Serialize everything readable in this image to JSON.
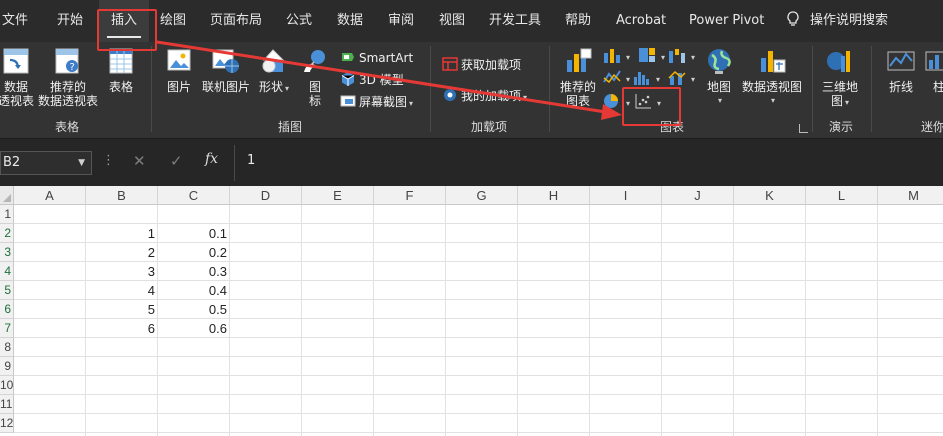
{
  "tabs": [
    {
      "label": "文件"
    },
    {
      "label": "开始"
    },
    {
      "label": "插入"
    },
    {
      "label": "绘图"
    },
    {
      "label": "页面布局"
    },
    {
      "label": "公式"
    },
    {
      "label": "数据"
    },
    {
      "label": "审阅"
    },
    {
      "label": "视图"
    },
    {
      "label": "开发工具"
    },
    {
      "label": "帮助"
    },
    {
      "label": "Acrobat"
    },
    {
      "label": "Power Pivot"
    },
    {
      "label": "操作说明搜索"
    }
  ],
  "ribbon": {
    "tables": {
      "pivot_label_1": "数据",
      "pivot_label_2": "透视表",
      "recommended_pivot_1": "推荐的",
      "recommended_pivot_2": "数据透视表",
      "table_label": "表格",
      "group_label": "表格"
    },
    "illustrations": {
      "pictures": "图片",
      "online_pictures": "联机图片",
      "shapes": "形状",
      "icons_1": "图",
      "icons_2": "标",
      "smartart": "SmartArt",
      "model3d": "3D 模型",
      "screenshot": "屏幕截图",
      "group_label": "插图"
    },
    "addins": {
      "get_addins": "获取加载项",
      "my_addins": "我的加载项",
      "group_label": "加载项"
    },
    "charts": {
      "recommended_1": "推荐的",
      "recommended_2": "图表",
      "maps": "地图",
      "pivot_chart": "数据透视图",
      "group_label": "图表"
    },
    "tours": {
      "map3d_1": "三维地",
      "map3d_2": "图",
      "group_label": "演示"
    },
    "sparklines": {
      "line": "折线",
      "column": "柱",
      "group_label": "迷你"
    }
  },
  "formula_bar": {
    "name_box": "B2",
    "fx": "fx",
    "value": "1"
  },
  "sheet": {
    "columns": [
      "A",
      "B",
      "C",
      "D",
      "E",
      "F",
      "G",
      "H",
      "I",
      "J",
      "K",
      "L",
      "M"
    ],
    "rows": [
      "1",
      "2",
      "3",
      "4",
      "5",
      "6",
      "7",
      "8",
      "9",
      "10",
      "11",
      "12"
    ],
    "col_b": [
      "1",
      "2",
      "3",
      "4",
      "5",
      "6"
    ],
    "col_c": [
      "0.1",
      "0.2",
      "0.3",
      "0.4",
      "0.5",
      "0.6"
    ]
  },
  "colors": {
    "annotation": "#e53935",
    "tabbar_bg": "#2b2b2b",
    "ribbon_bg": "#333333",
    "active_row_header": "#1e6e3a"
  }
}
